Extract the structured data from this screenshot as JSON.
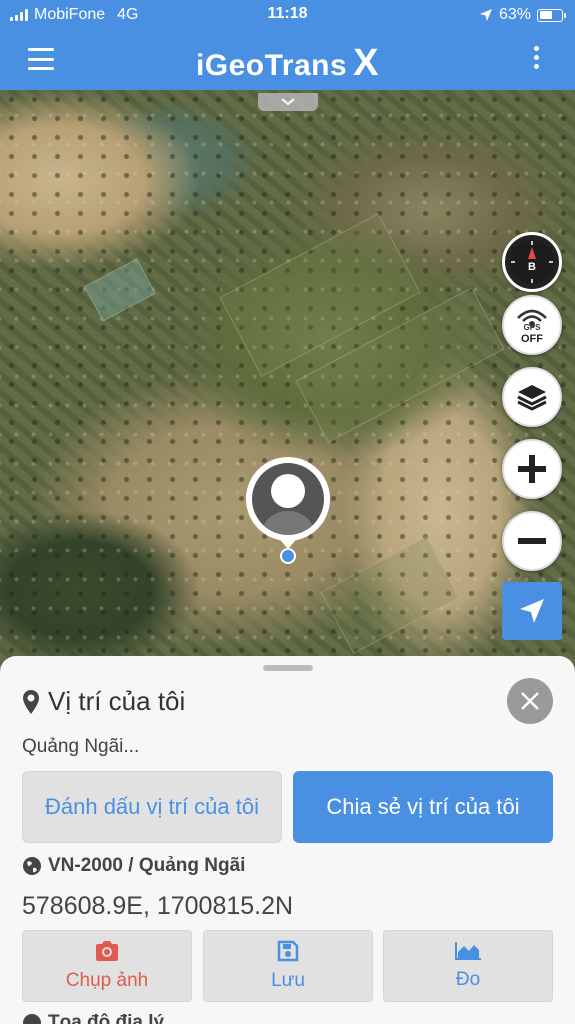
{
  "status_bar": {
    "carrier": "MobiFone",
    "network": "4G",
    "time": "11:18",
    "battery_percent": "63%",
    "battery_level": 0.63,
    "location_icon": "location-arrow-icon"
  },
  "header": {
    "title": "iGeoTrans",
    "title_suffix": "X",
    "menu_icon": "hamburger-menu-icon",
    "more_icon": "vertical-dots-icon"
  },
  "map": {
    "compass_label": "B",
    "gps_label": "GPS",
    "gps_state": "OFF",
    "controls": [
      "compass",
      "gps-toggle",
      "layers",
      "zoom-in",
      "zoom-out",
      "locate"
    ]
  },
  "location_panel": {
    "title": "Vị trí của tôi",
    "address": "Quảng Ngãi...",
    "mark_button": "Đánh dấu vị trí của tôi",
    "share_button": "Chia sẻ vị trí của tôi",
    "crs": "VN-2000 / Quảng Ngãi",
    "coordinates": "578608.9E, 1700815.2N",
    "actions": [
      {
        "label": "Chụp ảnh",
        "icon": "camera-icon"
      },
      {
        "label": "Lưu",
        "icon": "save-icon"
      },
      {
        "label": "Đo",
        "icon": "area-chart-icon"
      }
    ],
    "next_row": "Tọa độ địa lý"
  },
  "colors": {
    "primary": "#4a90e2",
    "danger": "#e05a4f",
    "panel_bg": "#f7f7f7"
  }
}
